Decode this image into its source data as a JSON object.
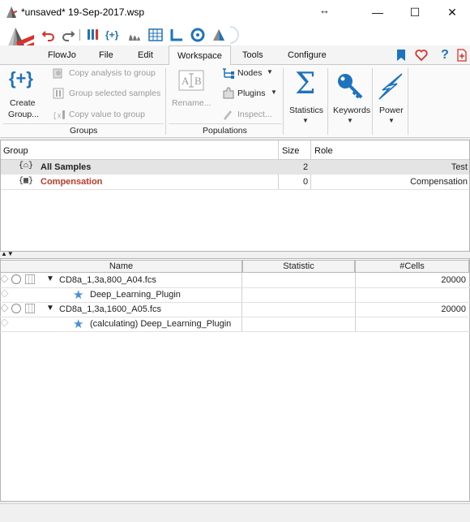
{
  "window": {
    "title": "*unsaved* 19-Sep-2017.wsp",
    "resize_glyph": "↔",
    "minimize": "—",
    "maximize": "☐",
    "close": "✕"
  },
  "menu": {
    "items": [
      "FlowJo",
      "File",
      "Edit",
      "Workspace",
      "Tools",
      "Configure"
    ],
    "active": "Workspace",
    "help": "?"
  },
  "ribbon": {
    "groups_title": "Groups",
    "populations_title": "Populations",
    "create_group_line1": "Create",
    "create_group_line2": "Group...",
    "copy_analysis": "Copy analysis to group",
    "group_selected": "Group selected samples",
    "copy_value": "Copy value to group",
    "rename": "Rename...",
    "nodes": "Nodes",
    "plugins": "Plugins",
    "inspect": "Inspect...",
    "statistics": "Statistics",
    "keywords": "Keywords",
    "power": "Power",
    "plus_glyph": "{+}",
    "sigma_glyph": "Σ"
  },
  "groups_table": {
    "headers": [
      "Group",
      "Size",
      "Role"
    ],
    "rows": [
      {
        "icon_glyph": "{⌂}",
        "name": "All Samples",
        "size": "2",
        "role": "Test",
        "color": "#000000",
        "selected": true
      },
      {
        "icon_glyph": "{▦}",
        "name": "Compensation",
        "size": "0",
        "role": "Compensation",
        "color": "#c0392b",
        "selected": false
      }
    ]
  },
  "samples_table": {
    "headers": [
      "Name",
      "Statistic",
      "#Cells"
    ],
    "rows": [
      {
        "type": "sample",
        "name": "CD8a_1,3a,800_A04.fcs",
        "statistic": "",
        "cells": "20000"
      },
      {
        "type": "plugin",
        "name": "Deep_Learning_Plugin",
        "statistic": "",
        "cells": ""
      },
      {
        "type": "sample",
        "name": "CD8a_1,3a,1600_A05.fcs",
        "statistic": "",
        "cells": "20000"
      },
      {
        "type": "plugin",
        "name": "(calculating) Deep_Learning_Plugin",
        "statistic": "",
        "cells": ""
      }
    ]
  },
  "colors": {
    "accent_blue": "#1e73be",
    "compensation_red": "#c0392b",
    "logo_red": "#d9322b"
  }
}
